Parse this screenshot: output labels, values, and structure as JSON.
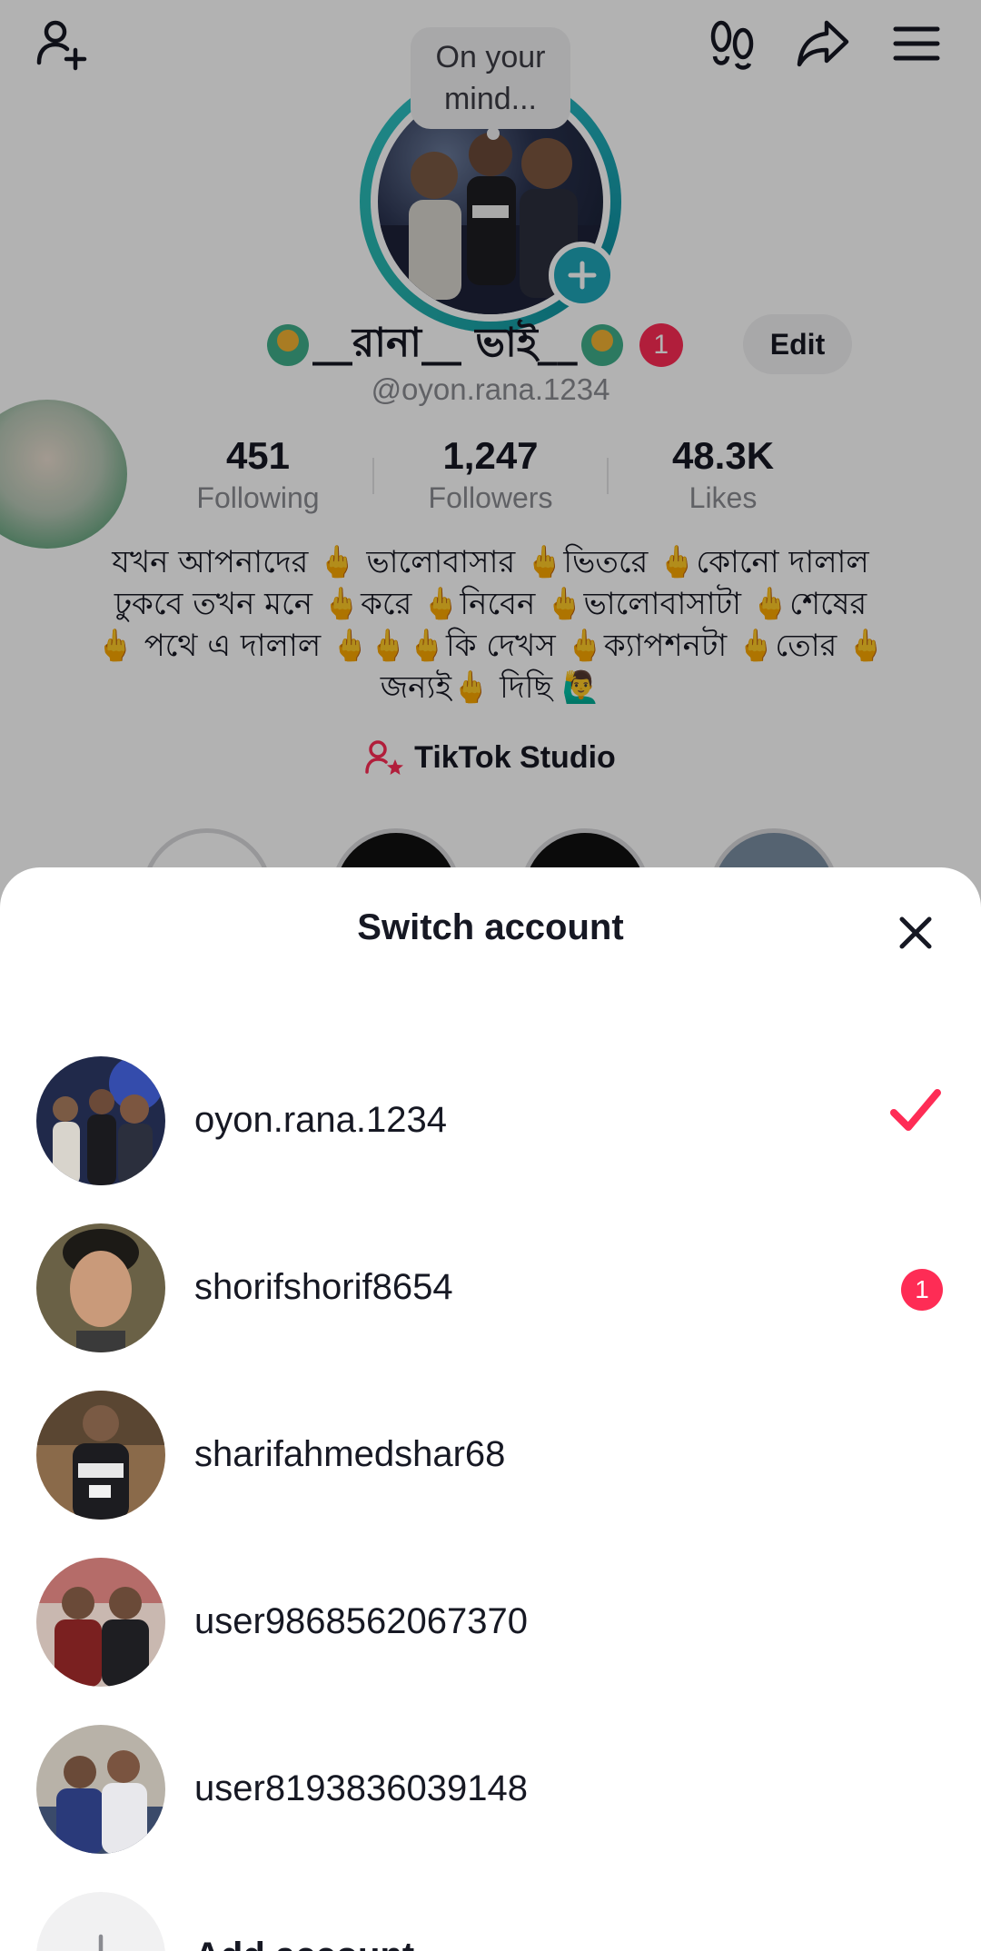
{
  "profile": {
    "bubble_text": "On your mind...",
    "display_name": "__রানা__ ভাই__",
    "notification_count": "1",
    "edit_label": "Edit",
    "handle": "@oyon.rana.1234",
    "stats": [
      {
        "value": "451",
        "label": "Following"
      },
      {
        "value": "1,247",
        "label": "Followers"
      },
      {
        "value": "48.3K",
        "label": "Likes"
      }
    ],
    "bio": "যখন আপনাদের 🖕 ভালোবাসার 🖕ভিতরে 🖕কোনো দালাল ঢুকবে তখন মনে 🖕করে 🖕নিবেন 🖕ভালোবাসাটা 🖕শেষের 🖕 পথে এ দালাল 🖕🖕🖕কি দেখস 🖕ক্যাপশনটা 🖕তোর 🖕জন্যই🖕 দিছি 🙋‍♂️",
    "studio_label": "TikTok Studio"
  },
  "sheet": {
    "title": "Switch account",
    "accounts": [
      {
        "username": "oyon.rana.1234",
        "selected": true,
        "badge": ""
      },
      {
        "username": "shorifshorif8654",
        "selected": false,
        "badge": "1"
      },
      {
        "username": "sharifahmedshar68",
        "selected": false,
        "badge": ""
      },
      {
        "username": "user9868562067370",
        "selected": false,
        "badge": ""
      },
      {
        "username": "user8193836039148",
        "selected": false,
        "badge": ""
      }
    ],
    "add_label": "Add account"
  },
  "colors": {
    "accent": "#fe2c55",
    "ring": "#1fa5b8",
    "text": "#161823",
    "muted": "#8a8b91"
  },
  "icons": [
    "add-friend-icon",
    "footprints-icon",
    "share-icon",
    "menu-icon",
    "plus-icon",
    "studio-icon",
    "close-icon",
    "check-icon"
  ]
}
